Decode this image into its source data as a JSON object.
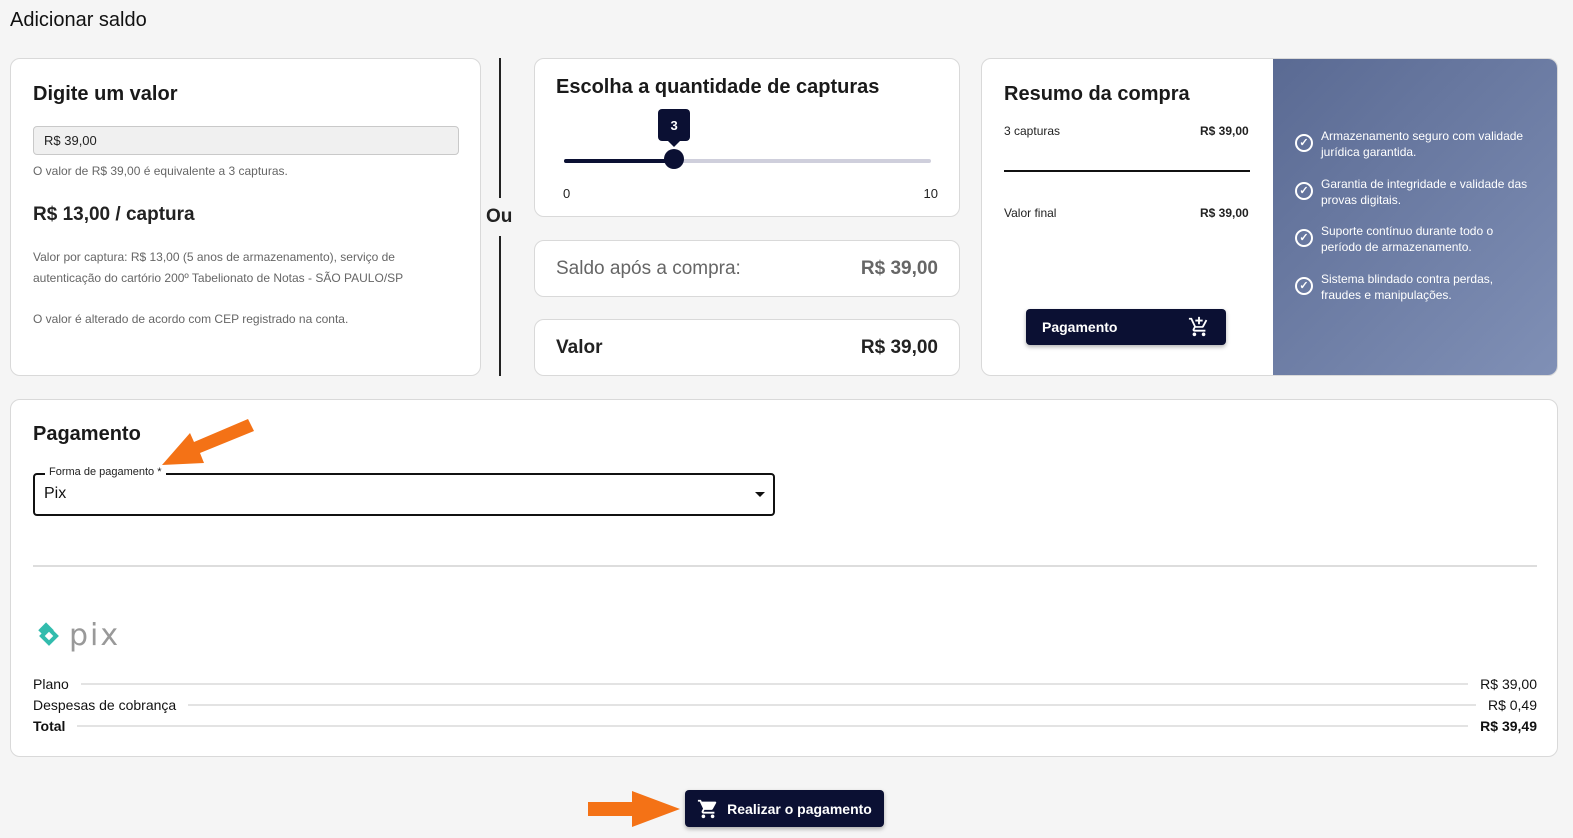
{
  "page": {
    "title": "Adicionar saldo"
  },
  "valor_card": {
    "title": "Digite um valor",
    "input_value": "R$ 39,00",
    "helper": "O valor de R$ 39,00 é equivalente a 3 capturas.",
    "price_per": "R$ 13,00 / captura",
    "note_1": "Valor por captura: R$ 13,00 (5 anos de armazenamento), serviço de",
    "note_2": "autenticação do cartório 200º Tabelionato de Notas - SÃO PAULO/SP",
    "note_3": "O valor é alterado de acordo com CEP registrado na conta."
  },
  "divider": {
    "label": "Ou"
  },
  "slider_card": {
    "title": "Escolha a quantidade de capturas",
    "value": 3,
    "min": 0,
    "max": 10,
    "value_label": "3",
    "min_label": "0",
    "max_label": "10"
  },
  "saldo_card": {
    "label": "Saldo após a compra:",
    "value": "R$ 39,00"
  },
  "total_card": {
    "label": "Valor",
    "value": "R$ 39,00"
  },
  "resumo": {
    "title": "Resumo da compra",
    "line_label": "3 capturas",
    "line_value": "R$ 39,00",
    "final_label": "Valor final",
    "final_value": "R$ 39,00",
    "button_label": "Pagamento",
    "features": [
      "Armazenamento seguro com validade jurídica garantida.",
      "Garantia de integridade e validade das provas digitais.",
      "Suporte contínuo durante todo o período de armazenamento.",
      "Sistema blindado contra perdas, fraudes e manipulações."
    ]
  },
  "pagamento": {
    "title": "Pagamento",
    "select_label": "Forma de pagamento",
    "select_value": "Pix",
    "logo_text": "pix",
    "rows": [
      {
        "label": "Plano",
        "value": "R$ 39,00"
      },
      {
        "label": "Despesas de cobrança",
        "value": "R$ 0,49"
      },
      {
        "label": "Total",
        "value": "R$ 39,49"
      }
    ]
  },
  "actions": {
    "submit_label": "Realizar o pagamento"
  },
  "colors": {
    "primary": "#0b1033",
    "arrow": "#f47216"
  }
}
